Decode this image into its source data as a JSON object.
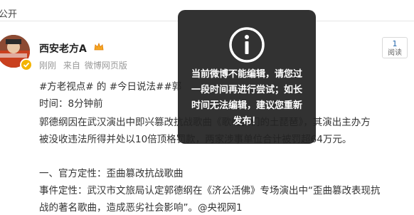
{
  "topbar": {
    "label": "公开"
  },
  "post": {
    "author": "西安老方A",
    "meta": {
      "time": "刚刚",
      "from_prefix": "来自",
      "source": "微博网页版"
    },
    "read_count": "1",
    "read_label": "阅读",
    "lines": [
      "#方老视点# 的 #今日说法##郭",
      "时间：8分钟前",
      "郭德纲因在武汉演出中即兴篡改抗战歌曲《歌唱我们的土琵琶》，其演出主办方",
      "被没收违法所得并处以10倍顶格罚款，两家涉事单位合计被罚超64万元。",
      "",
      "一、官方定性：歪曲篡改抗战歌曲",
      "事件定性：武汉市文旅局认定郭德纲在《济公活佛》专场演出中“歪曲篡改表现抗",
      "战的著名歌曲，造成恶劣社会影响”。@央视网1"
    ]
  },
  "toast": {
    "icon": "info-icon",
    "message": "当前微博不能编辑，请您过一段时间再进行尝试；如长时间无法编辑，建议您重新发布！"
  }
}
